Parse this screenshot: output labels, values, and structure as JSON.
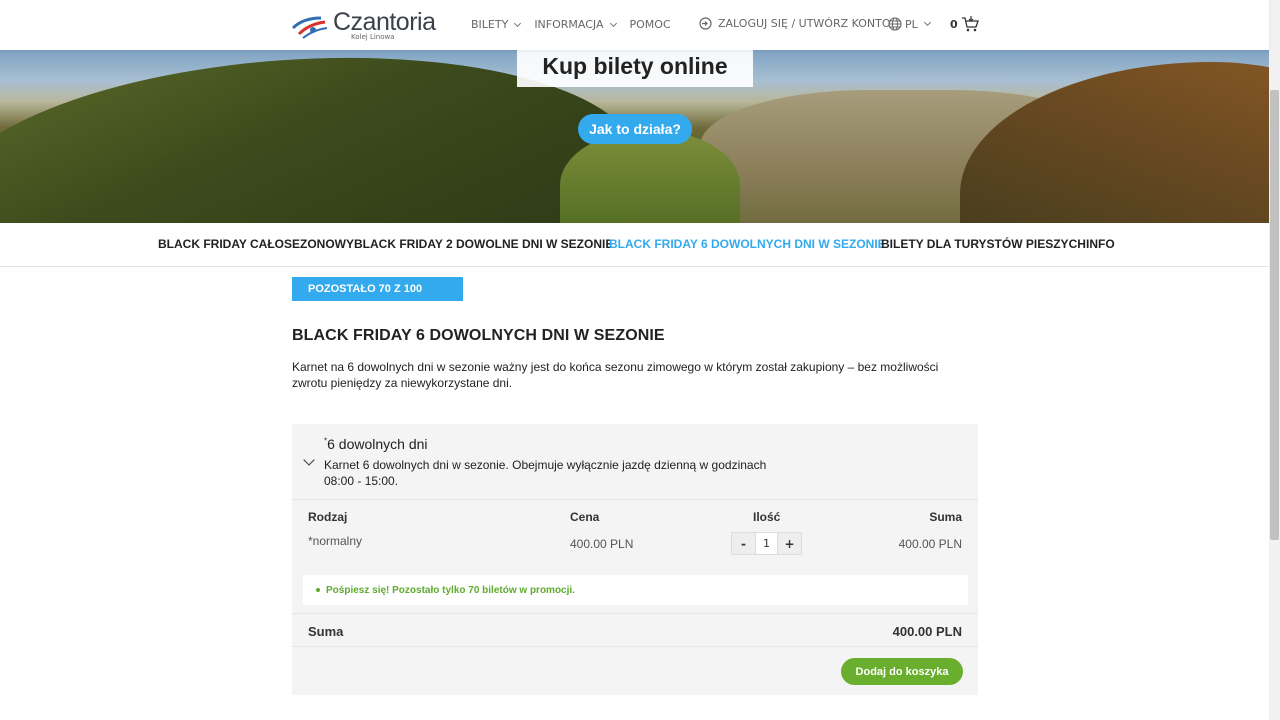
{
  "header": {
    "logo_name": "Czantoria",
    "logo_sub": "Kolej Linowa",
    "nav": [
      {
        "label": "BILETY",
        "dropdown": true
      },
      {
        "label": "INFORMACJA",
        "dropdown": true
      },
      {
        "label": "POMOC",
        "dropdown": false
      }
    ],
    "login_label": "ZALOGUJ SIĘ / UTWÓRZ KONTO",
    "lang_label": "PL",
    "cart_count": "0"
  },
  "hero": {
    "title": "Kup bilety online",
    "button_label": "Jak to działa?"
  },
  "tabs": [
    {
      "label": "BLACK FRIDAY CAŁOSEZONOWY",
      "active": false
    },
    {
      "label": "BLACK FRIDAY 2 DOWOLNE DNI W SEZONIE",
      "active": false
    },
    {
      "label": "BLACK FRIDAY 6 DOWOLNYCH DNI W SEZONIE",
      "active": true
    },
    {
      "label": "BILETY DLA TURYSTÓW PIESZYCH",
      "active": false
    },
    {
      "label": "INFO",
      "active": false
    }
  ],
  "remaining_badge": "POZOSTAŁO 70 Z 100",
  "section": {
    "title": "BLACK FRIDAY 6 DOWOLNYCH DNI W SEZONIE",
    "description": "Karnet na 6 dowolnych dni w sezonie ważny jest do końca sezonu zimowego w którym został zakupiony – bez możliwości zwrotu pieniędzy za niewykorzystane dni."
  },
  "ticket": {
    "name_prefix": "*",
    "name": "6 dowolnych dni",
    "description": "Karnet 6 dowolnych dni w sezonie. Obejmuje wyłącznie jazdę dzienną w godzinach 08:00 - 15:00.",
    "columns": {
      "type": "Rodzaj",
      "price": "Cena",
      "qty": "Ilość",
      "sum": "Suma"
    },
    "row": {
      "type": "*normalny",
      "price": "400.00 PLN",
      "qty": "1",
      "sum": "400.00 PLN",
      "minus": "-",
      "plus": "+"
    },
    "notice": "Pośpiesz się! Pozostało tylko 70 biletów w promocji.",
    "total_label": "Suma",
    "total_value": "400.00 PLN",
    "add_button": "Dodaj do koszyka"
  },
  "colors": {
    "accent": "#33aaee",
    "green": "#6aae2e",
    "notice_green": "#5fab2e"
  }
}
